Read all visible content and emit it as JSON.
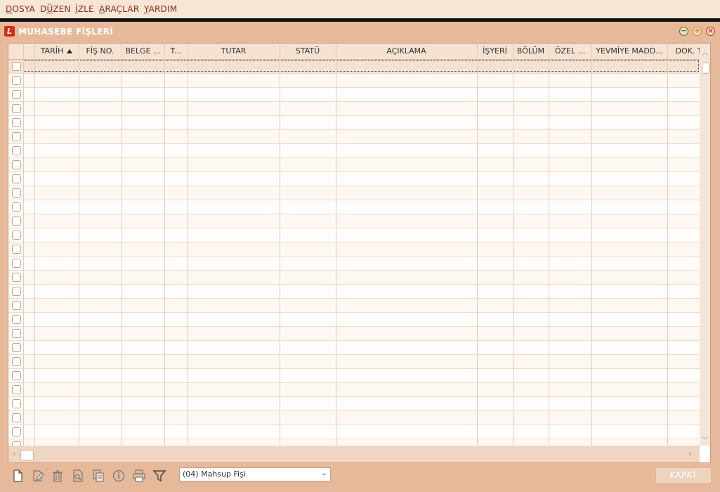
{
  "menu": [
    {
      "key": "D",
      "rest": "OSYA"
    },
    {
      "key": "D",
      "rest": "ÜZEN",
      "pre": "",
      "underline_index": 1
    },
    {
      "key": "İ",
      "rest": "ZLE"
    },
    {
      "key": "A",
      "rest": "RAÇLAR"
    },
    {
      "key": "Y",
      "rest": "ARDIM"
    }
  ],
  "menu_labels": [
    "DOSYA",
    "DÜZEN",
    "İZLE",
    "ARAÇLAR",
    "YARDIM"
  ],
  "window": {
    "title": "MUHASEBE FİŞLERİ",
    "logo_letter": "L",
    "minimize_glyph": "−",
    "maximize_glyph": "+",
    "close_glyph": "×"
  },
  "grid": {
    "columns": [
      {
        "label": "TARİH",
        "sorted": "asc"
      },
      {
        "label": "FİŞ NO."
      },
      {
        "label": "BELGE ..."
      },
      {
        "label": "T..."
      },
      {
        "label": "TUTAR"
      },
      {
        "label": "STATÜ"
      },
      {
        "label": "AÇIKLAMA"
      },
      {
        "label": "İŞYERİ"
      },
      {
        "label": "BÖLÜM"
      },
      {
        "label": "ÖZEL ..."
      },
      {
        "label": "YEVMİYE MADD..."
      },
      {
        "label": "DOK. T"
      }
    ],
    "row_count": 28
  },
  "toolbar": {
    "icons": [
      "new-document-icon",
      "edit-icon",
      "delete-icon",
      "preview-icon",
      "copy-icon",
      "info-icon",
      "print-icon",
      "filter-icon"
    ],
    "fis_type": "(04) Mahsup Fişi",
    "close_label": "KAPAT"
  },
  "colors": {
    "accent": "#8a2b1a",
    "window_bg": "#e5b99a",
    "menu_bg": "#f7e5d5"
  }
}
